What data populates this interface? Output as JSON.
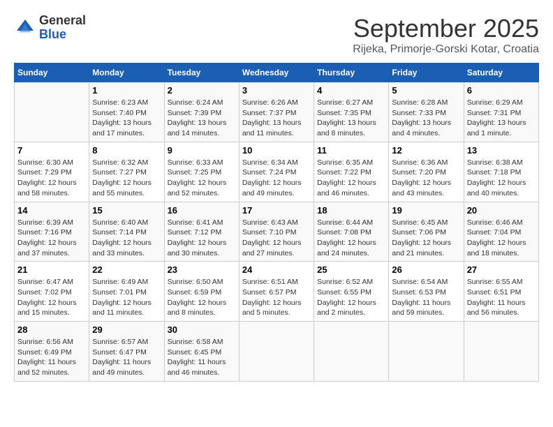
{
  "header": {
    "logo_general": "General",
    "logo_blue": "Blue",
    "month_title": "September 2025",
    "subtitle": "Rijeka, Primorje-Gorski Kotar, Croatia"
  },
  "weekdays": [
    "Sunday",
    "Monday",
    "Tuesday",
    "Wednesday",
    "Thursday",
    "Friday",
    "Saturday"
  ],
  "weeks": [
    [
      {
        "day": "",
        "info": ""
      },
      {
        "day": "1",
        "info": "Sunrise: 6:23 AM\nSunset: 7:40 PM\nDaylight: 13 hours and 17 minutes."
      },
      {
        "day": "2",
        "info": "Sunrise: 6:24 AM\nSunset: 7:39 PM\nDaylight: 13 hours and 14 minutes."
      },
      {
        "day": "3",
        "info": "Sunrise: 6:26 AM\nSunset: 7:37 PM\nDaylight: 13 hours and 11 minutes."
      },
      {
        "day": "4",
        "info": "Sunrise: 6:27 AM\nSunset: 7:35 PM\nDaylight: 13 hours and 8 minutes."
      },
      {
        "day": "5",
        "info": "Sunrise: 6:28 AM\nSunset: 7:33 PM\nDaylight: 13 hours and 4 minutes."
      },
      {
        "day": "6",
        "info": "Sunrise: 6:29 AM\nSunset: 7:31 PM\nDaylight: 13 hours and 1 minute."
      }
    ],
    [
      {
        "day": "7",
        "info": "Sunrise: 6:30 AM\nSunset: 7:29 PM\nDaylight: 12 hours and 58 minutes."
      },
      {
        "day": "8",
        "info": "Sunrise: 6:32 AM\nSunset: 7:27 PM\nDaylight: 12 hours and 55 minutes."
      },
      {
        "day": "9",
        "info": "Sunrise: 6:33 AM\nSunset: 7:25 PM\nDaylight: 12 hours and 52 minutes."
      },
      {
        "day": "10",
        "info": "Sunrise: 6:34 AM\nSunset: 7:24 PM\nDaylight: 12 hours and 49 minutes."
      },
      {
        "day": "11",
        "info": "Sunrise: 6:35 AM\nSunset: 7:22 PM\nDaylight: 12 hours and 46 minutes."
      },
      {
        "day": "12",
        "info": "Sunrise: 6:36 AM\nSunset: 7:20 PM\nDaylight: 12 hours and 43 minutes."
      },
      {
        "day": "13",
        "info": "Sunrise: 6:38 AM\nSunset: 7:18 PM\nDaylight: 12 hours and 40 minutes."
      }
    ],
    [
      {
        "day": "14",
        "info": "Sunrise: 6:39 AM\nSunset: 7:16 PM\nDaylight: 12 hours and 37 minutes."
      },
      {
        "day": "15",
        "info": "Sunrise: 6:40 AM\nSunset: 7:14 PM\nDaylight: 12 hours and 33 minutes."
      },
      {
        "day": "16",
        "info": "Sunrise: 6:41 AM\nSunset: 7:12 PM\nDaylight: 12 hours and 30 minutes."
      },
      {
        "day": "17",
        "info": "Sunrise: 6:43 AM\nSunset: 7:10 PM\nDaylight: 12 hours and 27 minutes."
      },
      {
        "day": "18",
        "info": "Sunrise: 6:44 AM\nSunset: 7:08 PM\nDaylight: 12 hours and 24 minutes."
      },
      {
        "day": "19",
        "info": "Sunrise: 6:45 AM\nSunset: 7:06 PM\nDaylight: 12 hours and 21 minutes."
      },
      {
        "day": "20",
        "info": "Sunrise: 6:46 AM\nSunset: 7:04 PM\nDaylight: 12 hours and 18 minutes."
      }
    ],
    [
      {
        "day": "21",
        "info": "Sunrise: 6:47 AM\nSunset: 7:02 PM\nDaylight: 12 hours and 15 minutes."
      },
      {
        "day": "22",
        "info": "Sunrise: 6:49 AM\nSunset: 7:01 PM\nDaylight: 12 hours and 11 minutes."
      },
      {
        "day": "23",
        "info": "Sunrise: 6:50 AM\nSunset: 6:59 PM\nDaylight: 12 hours and 8 minutes."
      },
      {
        "day": "24",
        "info": "Sunrise: 6:51 AM\nSunset: 6:57 PM\nDaylight: 12 hours and 5 minutes."
      },
      {
        "day": "25",
        "info": "Sunrise: 6:52 AM\nSunset: 6:55 PM\nDaylight: 12 hours and 2 minutes."
      },
      {
        "day": "26",
        "info": "Sunrise: 6:54 AM\nSunset: 6:53 PM\nDaylight: 11 hours and 59 minutes."
      },
      {
        "day": "27",
        "info": "Sunrise: 6:55 AM\nSunset: 6:51 PM\nDaylight: 11 hours and 56 minutes."
      }
    ],
    [
      {
        "day": "28",
        "info": "Sunrise: 6:56 AM\nSunset: 6:49 PM\nDaylight: 11 hours and 52 minutes."
      },
      {
        "day": "29",
        "info": "Sunrise: 6:57 AM\nSunset: 6:47 PM\nDaylight: 11 hours and 49 minutes."
      },
      {
        "day": "30",
        "info": "Sunrise: 6:58 AM\nSunset: 6:45 PM\nDaylight: 11 hours and 46 minutes."
      },
      {
        "day": "",
        "info": ""
      },
      {
        "day": "",
        "info": ""
      },
      {
        "day": "",
        "info": ""
      },
      {
        "day": "",
        "info": ""
      }
    ]
  ]
}
